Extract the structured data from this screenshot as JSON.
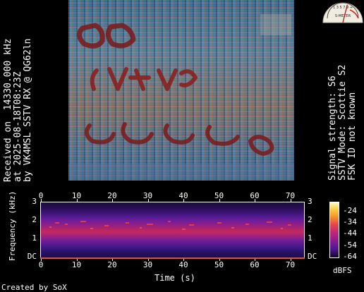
{
  "left_caption": {
    "line1": "Received on  14330.000 kHz",
    "line2": "at 2025-08-18T08:23Z",
    "line3": "by VK4MSL SSTV RX @ QG62ln"
  },
  "right_caption": {
    "line1": "Signal strength: S6",
    "line2": "SSTV Mode: Scottie S2",
    "line3": "FSK ID not known"
  },
  "smeter": {
    "scale_text": "S-METER",
    "digits": "1 3 5 7 9 +",
    "reading": "S6",
    "reading_fraction": 0.6
  },
  "spectrogram": {
    "xlabel": "Time (s)",
    "ylabel": "Frequency (kHz)",
    "x_ticks": [
      "0",
      "10",
      "20",
      "30",
      "40",
      "50",
      "60",
      "70"
    ],
    "y_ticks_left": [
      "3",
      "2",
      "1",
      "DC"
    ],
    "y_ticks_right": [
      "3",
      "2",
      "1",
      "DC"
    ],
    "colorbar_ticks": [
      "-24",
      "-34",
      "-44",
      "-54",
      "-64"
    ],
    "colorbar_unit": "dBFS"
  },
  "footer": {
    "credit": "Created by SoX"
  },
  "colors": {
    "background": "#000000",
    "text": "#ffffff",
    "baseline": "#e85020"
  }
}
